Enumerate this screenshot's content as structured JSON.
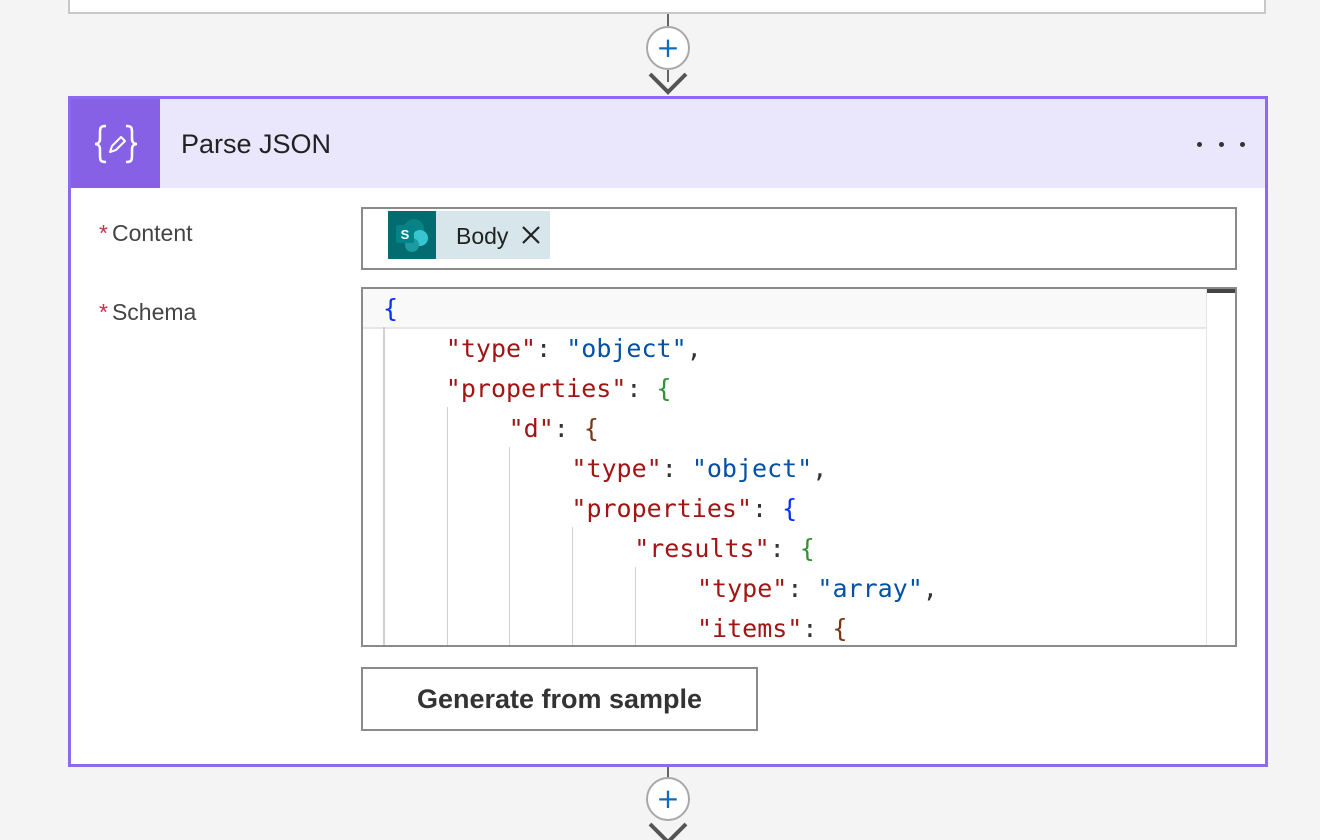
{
  "card": {
    "title": "Parse JSON",
    "accent_color": "#8661e6",
    "header_icon": "braces-edit-icon",
    "more_icon": "ellipsis-icon"
  },
  "content_field": {
    "required_mark": "*",
    "label": "Content",
    "token": {
      "label": "Body",
      "icon": "sharepoint-icon",
      "remove_icon": "close-icon"
    }
  },
  "schema_field": {
    "required_mark": "*",
    "label": "Schema",
    "code_lines": [
      {
        "indent": 0,
        "key": "",
        "value": "",
        "open": "{",
        "open_class": "b1",
        "comma": ""
      },
      {
        "indent": 1,
        "key": "\"type\"",
        "value": "\"object\"",
        "open": "",
        "open_class": "",
        "comma": ","
      },
      {
        "indent": 1,
        "key": "\"properties\"",
        "value": "",
        "open": "{",
        "open_class": "b2",
        "comma": ""
      },
      {
        "indent": 2,
        "key": "\"d\"",
        "value": "",
        "open": "{",
        "open_class": "b3",
        "comma": ""
      },
      {
        "indent": 3,
        "key": "\"type\"",
        "value": "\"object\"",
        "open": "",
        "open_class": "",
        "comma": ","
      },
      {
        "indent": 3,
        "key": "\"properties\"",
        "value": "",
        "open": "{",
        "open_class": "b1",
        "comma": ""
      },
      {
        "indent": 4,
        "key": "\"results\"",
        "value": "",
        "open": "{",
        "open_class": "b2",
        "comma": ""
      },
      {
        "indent": 5,
        "key": "\"type\"",
        "value": "\"array\"",
        "open": "",
        "open_class": "",
        "comma": ","
      },
      {
        "indent": 5,
        "key": "\"items\"",
        "value": "",
        "open": "{",
        "open_class": "b3",
        "comma": ""
      }
    ]
  },
  "actions": {
    "generate_label": "Generate from sample"
  },
  "connectors": {
    "add_symbol": "+"
  }
}
